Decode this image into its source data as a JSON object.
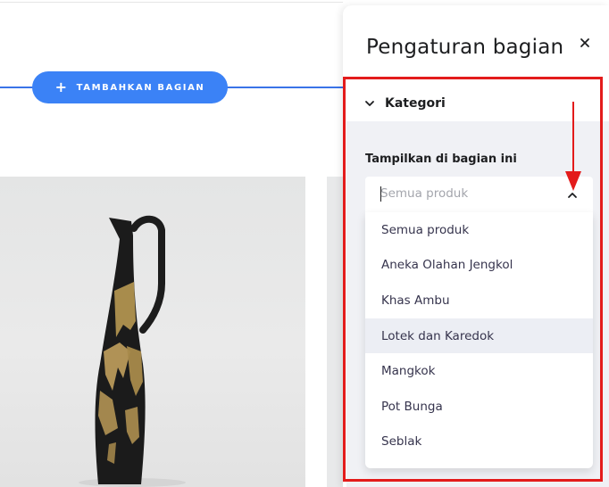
{
  "canvas": {
    "add_section_label": "TAMBAHKAN BAGIAN",
    "accent_color": "#3b82f6"
  },
  "panel": {
    "title": "Pengaturan bagian",
    "close_icon": "close-icon",
    "section": {
      "label": "Kategori",
      "expanded": true,
      "field_label": "Tampilkan di bagian ini",
      "select": {
        "placeholder": "Semua produk",
        "value": "",
        "open": true
      },
      "options": [
        "Semua produk",
        "Aneka Olahan Jengkol",
        "Khas Ambu",
        "Lotek dan Karedok",
        "Mangkok",
        "Pot Bunga",
        "Seblak"
      ],
      "hovered_option": "Lotek dan Karedok"
    }
  },
  "annotation": {
    "color": "#e31b1b"
  }
}
